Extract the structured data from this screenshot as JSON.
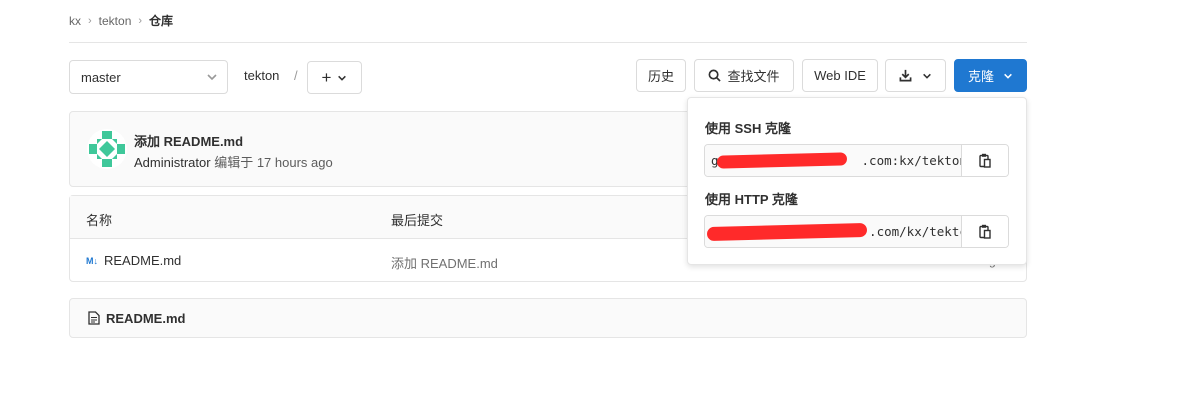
{
  "breadcrumb": [
    "kx",
    "tekton",
    "仓库"
  ],
  "toolbar": {
    "branch": "master",
    "path": "tekton",
    "path_sep": "/",
    "history": "历史",
    "find_file": "查找文件",
    "web_ide": "Web IDE",
    "clone": "克隆"
  },
  "commit": {
    "title": "添加 README.md",
    "author": "Administrator",
    "edited_at": "编辑于 17 hours ago"
  },
  "tree": {
    "headers": {
      "name": "名称",
      "last_commit": "最后提交"
    },
    "rows": [
      {
        "name": "README.md",
        "message": "添加 README.md",
        "time": "g"
      }
    ]
  },
  "readme": {
    "title": "README.md"
  },
  "clone_dropdown": {
    "ssh_label": "使用 SSH 克隆",
    "ssh_url_visible": "g                   .com:kx/tekton.g",
    "http_label": "使用 HTTP 克隆",
    "http_url_visible": "                     .com/kx/tektc"
  },
  "colors": {
    "primary": "#1f78d1",
    "redaction": "#ff2a2a",
    "avatar": "#3fc89a"
  }
}
